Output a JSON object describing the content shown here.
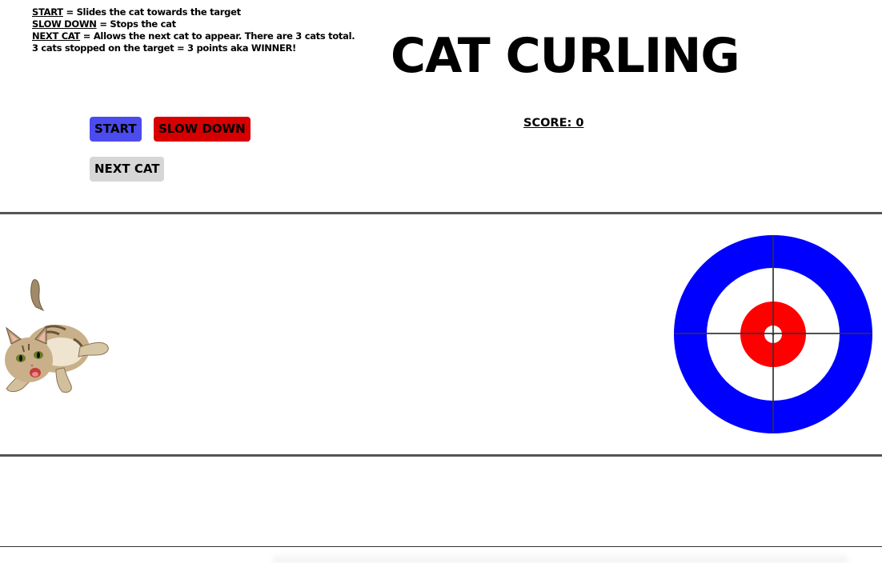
{
  "instructions": {
    "line1_key": "START",
    "line1_text": " = Slides the cat towards the target",
    "line2_key": "SLOW DOWN",
    "line2_text": " = Stops the cat",
    "line3_key": "NEXT CAT",
    "line3_text": " = Allows the next cat to appear. There are 3 cats total.",
    "line4_text": "3 cats stopped on the target = 3 points aka WINNER!"
  },
  "title": "CAT CURLING",
  "buttons": {
    "start": "START",
    "slow_down": "SLOW DOWN",
    "next_cat": "NEXT CAT"
  },
  "score_label": "SCORE: 0",
  "colors": {
    "start_button": "#4b4bee",
    "slow_button": "#d60000",
    "next_button": "#d6d6d6",
    "target_outer": "#0000ff",
    "target_mid": "#ffffff",
    "target_inner": "#ff0000"
  },
  "icons": {
    "cat": "cat-image",
    "target": "curling-target"
  }
}
